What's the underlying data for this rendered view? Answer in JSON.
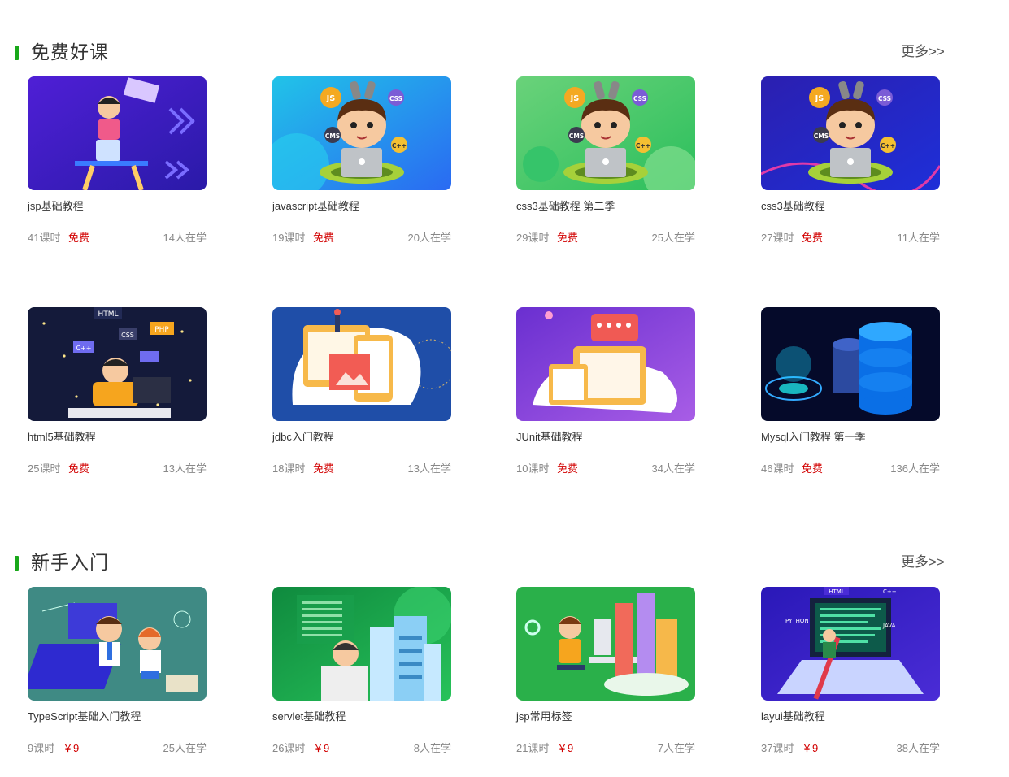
{
  "colors": {
    "accent_bar": "#19a81a",
    "price_red": "#d20000",
    "meta_gray": "#888888"
  },
  "sections": [
    {
      "title": "免费好课",
      "more": "更多>>",
      "courses": [
        {
          "title": "jsp基础教程",
          "lessons": "41课时",
          "price": "免费",
          "students": "14人在学",
          "thumb": "jsp"
        },
        {
          "title": "javascript基础教程",
          "lessons": "19课时",
          "price": "免费",
          "students": "20人在学",
          "thumb": "boy-blue"
        },
        {
          "title": "css3基础教程 第二季",
          "lessons": "29课时",
          "price": "免费",
          "students": "25人在学",
          "thumb": "boy-green"
        },
        {
          "title": "css3基础教程",
          "lessons": "27课时",
          "price": "免费",
          "students": "11人在学",
          "thumb": "boy-navy"
        },
        {
          "title": "html5基础教程",
          "lessons": "25课时",
          "price": "免费",
          "students": "13人在学",
          "thumb": "html5"
        },
        {
          "title": "jdbc入门教程",
          "lessons": "18课时",
          "price": "免费",
          "students": "13人在学",
          "thumb": "jdbc"
        },
        {
          "title": "JUnit基础教程",
          "lessons": "10课时",
          "price": "免费",
          "students": "34人在学",
          "thumb": "junit"
        },
        {
          "title": "Mysql入门教程 第一季",
          "lessons": "46课时",
          "price": "免费",
          "students": "136人在学",
          "thumb": "mysql"
        }
      ]
    },
    {
      "title": "新手入门",
      "more": "更多>>",
      "courses": [
        {
          "title": "TypeScript基础入门教程",
          "lessons": "9课时",
          "price": "￥9",
          "students": "25人在学",
          "thumb": "typescript"
        },
        {
          "title": "servlet基础教程",
          "lessons": "26课时",
          "price": "￥9",
          "students": "8人在学",
          "thumb": "servlet"
        },
        {
          "title": "jsp常用标签",
          "lessons": "21课时",
          "price": "￥9",
          "students": "7人在学",
          "thumb": "jsptags"
        },
        {
          "title": "layui基础教程",
          "lessons": "37课时",
          "price": "￥9",
          "students": "38人在学",
          "thumb": "layui"
        }
      ]
    }
  ],
  "thumb_labels": {
    "js": "JS",
    "css": "CSS",
    "cms": "CMS",
    "cpp": "C++",
    "html": "HTML",
    "php": "PHP",
    "code": "</>",
    "python": "PYTHON",
    "java": "JAVA"
  }
}
